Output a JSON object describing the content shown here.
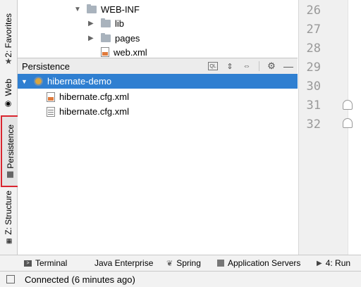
{
  "left_tabs": {
    "favorites": "2: Favorites",
    "web": "Web",
    "persistence": "Persistence",
    "structure": "Z: Structure"
  },
  "project_tree": {
    "items": [
      {
        "label": "WEB-INF",
        "type": "folder",
        "expanded": true
      },
      {
        "label": "lib",
        "type": "folder"
      },
      {
        "label": "pages",
        "type": "folder"
      },
      {
        "label": "web.xml",
        "type": "file"
      }
    ]
  },
  "persistence_panel": {
    "title": "Persistence",
    "root": "hibernate-demo",
    "children": [
      "hibernate.cfg.xml",
      "hibernate.cfg.xml"
    ]
  },
  "gutter": {
    "line_numbers": [
      "26",
      "27",
      "28",
      "29",
      "30",
      "31",
      "32"
    ]
  },
  "bottom_tabs": {
    "terminal": "Terminal",
    "java_enterprise": "Java Enterprise",
    "spring": "Spring",
    "app_servers": "Application Servers",
    "run": "4: Run"
  },
  "status_bar": {
    "text": "Connected (6 minutes ago)"
  },
  "colors": {
    "selection": "#2f7fd1",
    "highlight_border": "#d9252f"
  }
}
